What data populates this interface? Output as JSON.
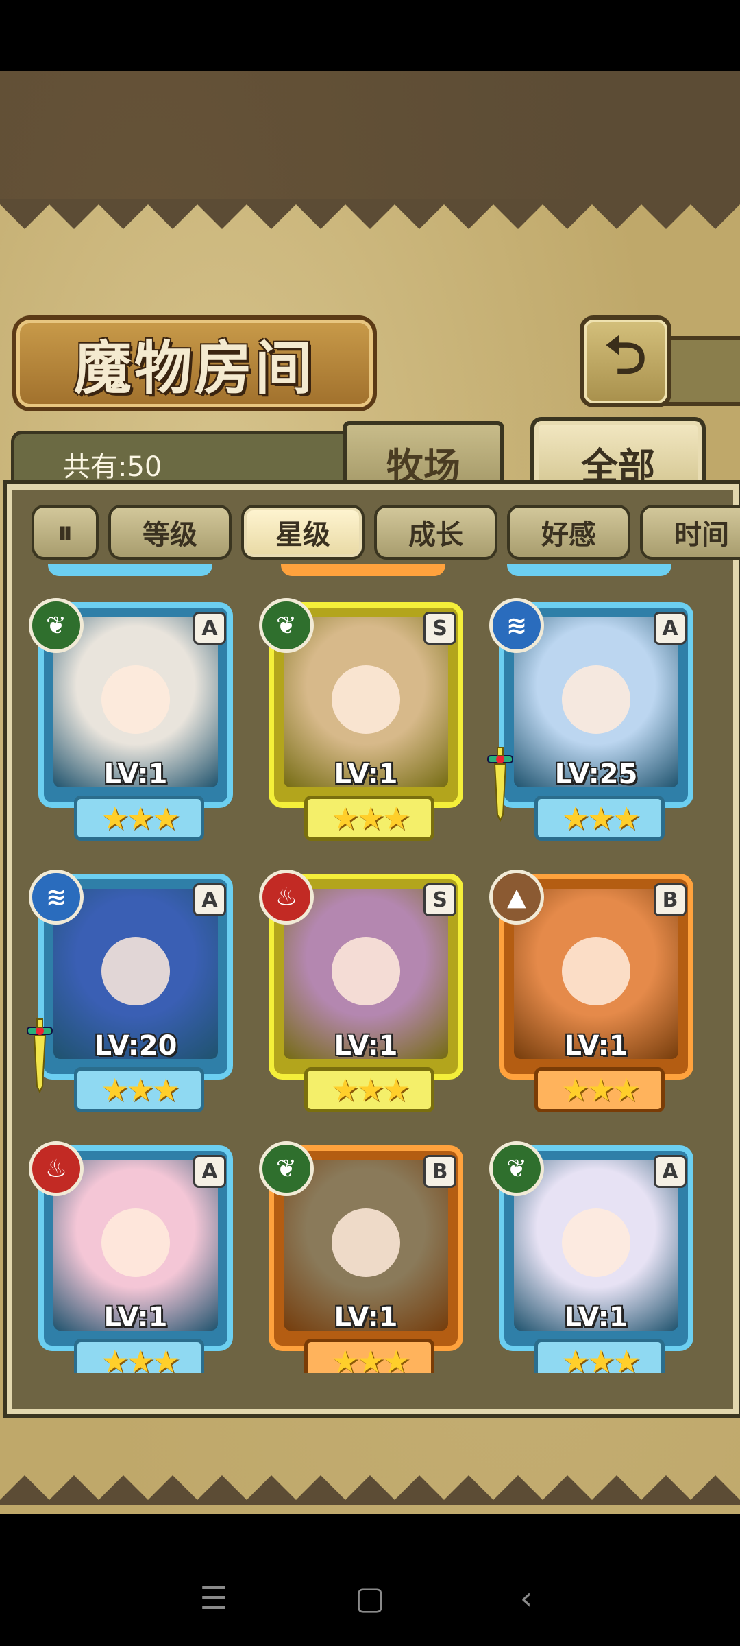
{
  "header": {
    "title": "魔物房间",
    "count_label": "共有:50",
    "tabs": [
      {
        "label": "牧场",
        "active": false
      },
      {
        "label": "全部",
        "active": true
      }
    ]
  },
  "filters": {
    "toggle_icon": "⏸",
    "items": [
      {
        "label": "等级",
        "selected": false
      },
      {
        "label": "星级",
        "selected": true
      },
      {
        "label": "成长",
        "selected": false
      },
      {
        "label": "好感",
        "selected": false
      },
      {
        "label": "时间",
        "selected": false
      }
    ]
  },
  "cards": [
    {
      "level": "LV:1",
      "rank": "A",
      "element": "grass-icon",
      "frame": "blue",
      "stars": 3,
      "equipped": false,
      "art_color": "#e9e4dc"
    },
    {
      "level": "LV:1",
      "rank": "S",
      "element": "grass-icon",
      "frame": "gold",
      "stars": 3,
      "equipped": false,
      "art_color": "#d7b98a"
    },
    {
      "level": "LV:25",
      "rank": "A",
      "element": "water-icon",
      "frame": "blue",
      "stars": 3,
      "equipped": true,
      "art_color": "#bcd6f0"
    },
    {
      "level": "LV:20",
      "rank": "A",
      "element": "water-icon",
      "frame": "blue",
      "stars": 3,
      "equipped": true,
      "art_color": "#3a5fb4"
    },
    {
      "level": "LV:1",
      "rank": "S",
      "element": "fire-icon",
      "frame": "gold",
      "stars": 3,
      "equipped": false,
      "art_color": "#b487b0"
    },
    {
      "level": "LV:1",
      "rank": "B",
      "element": "earth-icon",
      "frame": "orange",
      "stars": 3,
      "equipped": false,
      "art_color": "#e58a4a"
    },
    {
      "level": "LV:1",
      "rank": "A",
      "element": "fire-icon",
      "frame": "blue",
      "stars": 3,
      "equipped": false,
      "art_color": "#f4c6d6"
    },
    {
      "level": "LV:1",
      "rank": "B",
      "element": "grass-icon",
      "frame": "orange",
      "stars": 3,
      "equipped": false,
      "art_color": "#8a7a5a"
    },
    {
      "level": "LV:1",
      "rank": "A",
      "element": "grass-icon",
      "frame": "blue",
      "stars": 3,
      "equipped": false,
      "art_color": "#e7e2f4"
    }
  ],
  "element_glyphs": {
    "grass-icon": "❦",
    "water-icon": "≋",
    "fire-icon": "♨",
    "earth-icon": "▲"
  },
  "system_nav": [
    "menu-icon",
    "home-icon",
    "back-icon"
  ]
}
